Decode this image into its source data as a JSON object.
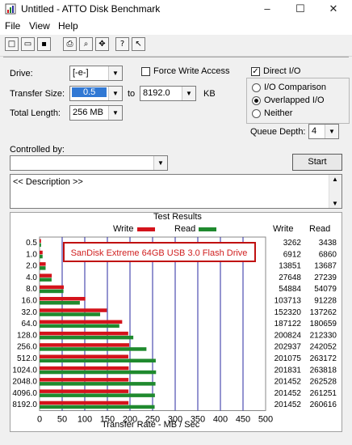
{
  "window": {
    "title": "Untitled - ATTO Disk Benchmark",
    "controls": [
      "–",
      "☐",
      "✕"
    ]
  },
  "menu": [
    "File",
    "View",
    "Help"
  ],
  "toolbar": [
    "new-icon",
    "open-icon",
    "save-icon",
    "print-icon",
    "print-preview-icon",
    "move-icon",
    "help-icon",
    "context-help-icon"
  ],
  "settings": {
    "drive_label": "Drive:",
    "drive_value": "[-e-]",
    "force_write_access_label": "Force Write Access",
    "force_write_access": false,
    "direct_io_label": "Direct I/O",
    "direct_io": true,
    "transfer_size_label": "Transfer Size:",
    "transfer_size_from": "0.5",
    "to_label": "to",
    "transfer_size_to": "8192.0",
    "unit_label": "KB",
    "total_length_label": "Total Length:",
    "total_length_value": "256 MB",
    "io_options": [
      "I/O Comparison",
      "Overlapped I/O",
      "Neither"
    ],
    "io_selected": 1,
    "queue_depth_label": "Queue Depth:",
    "queue_depth_value": "4",
    "controlled_by_label": "Controlled by:",
    "controlled_by_value": "",
    "start_label": "Start",
    "description_text": "<< Description >>"
  },
  "results": {
    "title": "Test Results",
    "legend_write": "Write",
    "legend_read": "Read",
    "col_write": "Write",
    "col_read": "Read",
    "annotation": "SanDisk Extreme 64GB USB 3.0 Flash Drive",
    "x_axis_label": "Transfer Rate - MB / Sec",
    "colors": {
      "write": "#d4131b",
      "read": "#1f8a2e",
      "grid": "#2a2aa0"
    }
  },
  "chart_data": {
    "type": "bar",
    "categories": [
      "0.5",
      "1.0",
      "2.0",
      "4.0",
      "8.0",
      "16.0",
      "32.0",
      "64.0",
      "128.0",
      "256.0",
      "512.0",
      "1024.0",
      "2048.0",
      "4096.0",
      "8192.0"
    ],
    "series": [
      {
        "name": "Write",
        "values": [
          3262,
          6912,
          13851,
          27648,
          54884,
          103713,
          152320,
          187122,
          200824,
          202937,
          201075,
          201831,
          201452,
          201452,
          201452
        ]
      },
      {
        "name": "Read",
        "values": [
          3438,
          6860,
          13687,
          27239,
          54079,
          91228,
          137262,
          180659,
          212330,
          242052,
          263172,
          263818,
          262528,
          261251,
          260616
        ]
      }
    ],
    "x_ticks": [
      "0",
      "50",
      "100",
      "150",
      "200",
      "250",
      "300",
      "350",
      "400",
      "450",
      "500"
    ],
    "xlim": [
      0,
      500
    ],
    "xlabel": "Transfer Rate - MB / Sec",
    "title": "Test Results",
    "grid": true,
    "legend": "top"
  }
}
